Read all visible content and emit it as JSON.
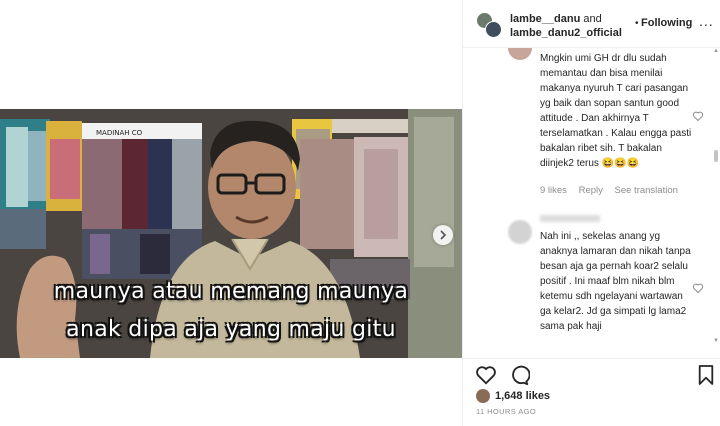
{
  "header": {
    "account_1": "lambe__danu",
    "and_text": "and",
    "account_2": "lambe_danu2_official",
    "dot": "•",
    "follow_label": "Following",
    "more_label": "..."
  },
  "video": {
    "subtitle_line_1": "maunya atau memang maunya",
    "subtitle_line_2": "anak dipa aja yang maju gitu",
    "shop_sign": "MADINAH CO",
    "next_icon": "chevron-right-icon"
  },
  "comments": [
    {
      "username": "",
      "text": "Mngkin umi GH dr dlu sudah memantau dan bisa menilai makanya nyuruh T cari pasangan yg baik dan sopan santun good attitude . Dan akhirnya T terselamatkan . Kalau engga pasti bakalan ribet sih. T bakalan diinjek2 terus 😆😆😆",
      "likes": "9 likes",
      "reply_label": "Reply",
      "translate_label": "See translation"
    },
    {
      "username": "",
      "text": "Nah ini ,, sekelas anang yg anaknya lamaran dan nikah tanpa besan aja ga pernah koar2 selalu positif . Ini maaf blm nikah blm ketemu sdh ngelayani wartawan ga kelar2. Jd ga simpati lg lama2 sama pak haji",
      "likes": "",
      "reply_label": "",
      "translate_label": ""
    }
  ],
  "actions": {
    "like_icon": "heart-icon",
    "comment_icon": "comment-icon",
    "save_icon": "bookmark-icon",
    "likes_count": "1,648 likes",
    "time_ago": "11 HOURS AGO"
  },
  "colors": {
    "border": "#efefef",
    "text": "#262626",
    "muted": "#8e8e8e"
  }
}
